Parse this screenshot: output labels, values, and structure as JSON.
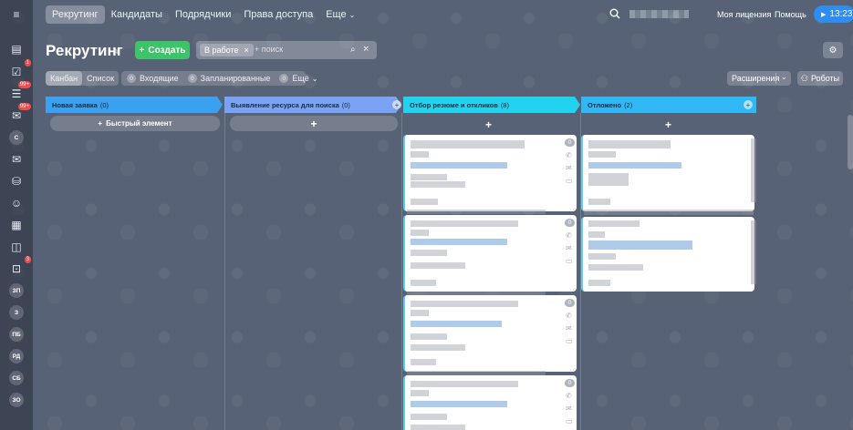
{
  "nav": {
    "menu_icon": "hamburger-icon",
    "tabs": [
      "Рекрутинг",
      "Кандидаты",
      "Подрядчики",
      "Права доступа",
      "Еще"
    ],
    "license": "Моя лицензия",
    "help": "Помощь",
    "time": "13:23"
  },
  "sidebar": {
    "icons": [
      "page-icon",
      "tasks-icon",
      "feed-icon",
      "chat-icon",
      "contact-initial",
      "mail-icon",
      "drive-icon",
      "users-icon",
      "calendar-icon",
      "chat-bubble-icon",
      "inbox-icon",
      "group-initial",
      "group-initial",
      "group-initial",
      "group-initial",
      "group-initial",
      "group-initial"
    ],
    "badges": [
      "1",
      "99+",
      "99+",
      "3"
    ],
    "initials": [
      "С",
      "ЗП",
      "З",
      "ПБ",
      "РД",
      "СБ",
      "ЗО"
    ]
  },
  "header": {
    "title": "Рекрутинг",
    "create": "Создать",
    "filter_chip": "В работе",
    "search_placeholder": "+ поиск"
  },
  "toolbar": {
    "views": [
      "Канбан",
      "Список"
    ],
    "counters": [
      {
        "count": "0",
        "label": "Входящие"
      },
      {
        "count": "0",
        "label": "Запланированные"
      },
      {
        "count": "0",
        "label": "Ещё"
      }
    ],
    "extensions": "Расширения",
    "robots": "Роботы"
  },
  "kanban": {
    "columns": [
      {
        "title": "Новая заявка",
        "count": "(0)",
        "color": "#3aa0f0"
      },
      {
        "title": "Выявление ресурса для поиска",
        "count": "(0)",
        "color": "#7aa3f5"
      },
      {
        "title": "Отбор резюме и откликов",
        "count": "(8)",
        "color": "#22d3f0"
      },
      {
        "title": "Отложено",
        "count": "(2)",
        "color": "#2fb8f5"
      }
    ],
    "quick_add": "Быстрый элемент",
    "card_badge": "0"
  }
}
